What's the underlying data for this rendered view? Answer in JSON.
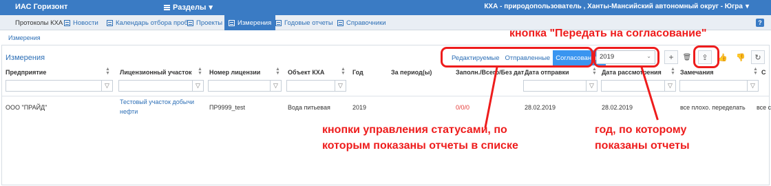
{
  "topbar": {
    "app_title": "ИАС Горизонт",
    "sections_label": "Разделы",
    "organization": "КХА - природопользователь , Ханты-Мансийский автономный округ - Югра"
  },
  "navbar": {
    "items": [
      {
        "label": "Протоколы КХА"
      },
      {
        "label": "Новости"
      },
      {
        "label": "Календарь отбора проб"
      },
      {
        "label": "Проекты"
      },
      {
        "label": "Измерения"
      },
      {
        "label": "Годовые отчеты"
      },
      {
        "label": "Справочники"
      }
    ],
    "help": "?"
  },
  "breadcrumb": "Измерения",
  "panel": {
    "title": "Измерения",
    "status_tabs": [
      "Редактируемые",
      "Отправленные",
      "Согласованные"
    ],
    "year": "2019"
  },
  "columns": [
    "Предприятие",
    "Лицензионный участок",
    "Номер лицензии",
    "Объект КХА",
    "Год",
    "За период(ы)",
    "Заполн./Всего/Без дат",
    "Дата отправки",
    "Дата рассмотрения",
    "Замечания",
    "С"
  ],
  "rows": [
    {
      "enterprise": "ООО \"ПРАЙД\"",
      "license_area_1": "Тестовый участок добычи",
      "license_area_2": "нефти",
      "license_number": "ПР9999_test",
      "object": "Вода питьевая",
      "year": "2019",
      "filled": "0/0/0",
      "sent_date": "28.02.2019",
      "review_date": "28.02.2019",
      "remarks": "все плохо. переделать",
      "extra": "все с"
    }
  ],
  "annotations": {
    "send_button": "кнопка \"Передать на согласование\"",
    "status_line1": "кнопки управления статусами, по",
    "status_line2": "которым показаны отчеты в списке",
    "year_line1": "год, по которому",
    "year_line2": "показаны отчеты"
  },
  "colors": {
    "header_blue": "#3a7bc4",
    "link_blue": "#2d6fb6",
    "annotation_red": "#ee1c1c"
  }
}
